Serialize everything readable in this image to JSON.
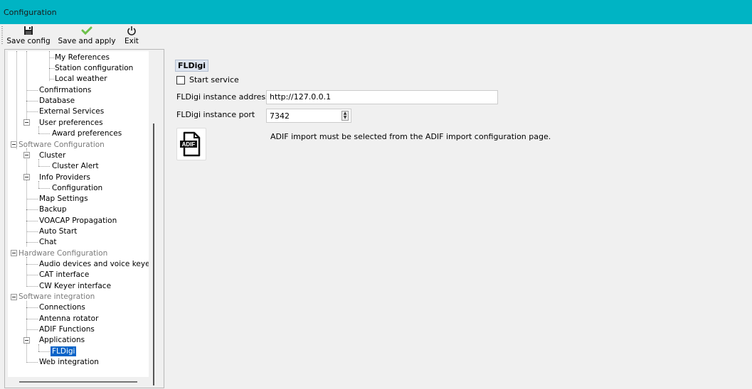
{
  "window": {
    "title": "Configuration"
  },
  "toolbar": {
    "save_config": "Save config",
    "save_and_apply": "Save and apply",
    "exit": "Exit"
  },
  "tree": {
    "items": [
      {
        "label": "My References",
        "grey": false,
        "selected": false
      },
      {
        "label": "Station configuration",
        "grey": false,
        "selected": false
      },
      {
        "label": "Local weather",
        "grey": false,
        "selected": false
      },
      {
        "label": "Confirmations",
        "grey": false,
        "selected": false
      },
      {
        "label": "Database",
        "grey": false,
        "selected": false
      },
      {
        "label": "External Services",
        "grey": false,
        "selected": false
      },
      {
        "label": "User preferences",
        "grey": false,
        "selected": false
      },
      {
        "label": "Award preferences",
        "grey": false,
        "selected": false
      },
      {
        "label": "Software Configuration",
        "grey": true,
        "selected": false
      },
      {
        "label": "Cluster",
        "grey": false,
        "selected": false
      },
      {
        "label": "Cluster Alert",
        "grey": false,
        "selected": false
      },
      {
        "label": "Info Providers",
        "grey": false,
        "selected": false
      },
      {
        "label": "Configuration",
        "grey": false,
        "selected": false
      },
      {
        "label": "Map Settings",
        "grey": false,
        "selected": false
      },
      {
        "label": "Backup",
        "grey": false,
        "selected": false
      },
      {
        "label": "VOACAP Propagation",
        "grey": false,
        "selected": false
      },
      {
        "label": "Auto Start",
        "grey": false,
        "selected": false
      },
      {
        "label": "Chat",
        "grey": false,
        "selected": false
      },
      {
        "label": "Hardware Configuration",
        "grey": true,
        "selected": false
      },
      {
        "label": "Audio devices and voice keye",
        "grey": false,
        "selected": false
      },
      {
        "label": "CAT interface",
        "grey": false,
        "selected": false
      },
      {
        "label": "CW Keyer interface",
        "grey": false,
        "selected": false
      },
      {
        "label": "Software integration",
        "grey": true,
        "selected": false
      },
      {
        "label": "Connections",
        "grey": false,
        "selected": false
      },
      {
        "label": "Antenna rotator",
        "grey": false,
        "selected": false
      },
      {
        "label": "ADIF Functions",
        "grey": false,
        "selected": false
      },
      {
        "label": "Applications",
        "grey": false,
        "selected": false
      },
      {
        "label": "FLDigi",
        "grey": false,
        "selected": true
      },
      {
        "label": "Web integration",
        "grey": false,
        "selected": false
      }
    ]
  },
  "panel": {
    "section_title": "FLDigi",
    "start_service_label": "Start service",
    "start_service_checked": false,
    "address_label": "FLDigi instance address",
    "address_value": "http://127.0.0.1",
    "port_label": "FLDigi instance port",
    "port_value": "7342",
    "adif_icon_text": "ADIF",
    "note": "ADIF import must be selected from the ADIF import configuration page."
  },
  "colors": {
    "titlebar": "#00b4c4",
    "selection": "#0a64c8",
    "save_and_apply_check": "#6cc04a"
  },
  "icons": {
    "save_config": "floppy-disk-icon",
    "save_and_apply": "checkmark-icon",
    "exit": "power-icon",
    "adif": "adif-file-icon"
  }
}
